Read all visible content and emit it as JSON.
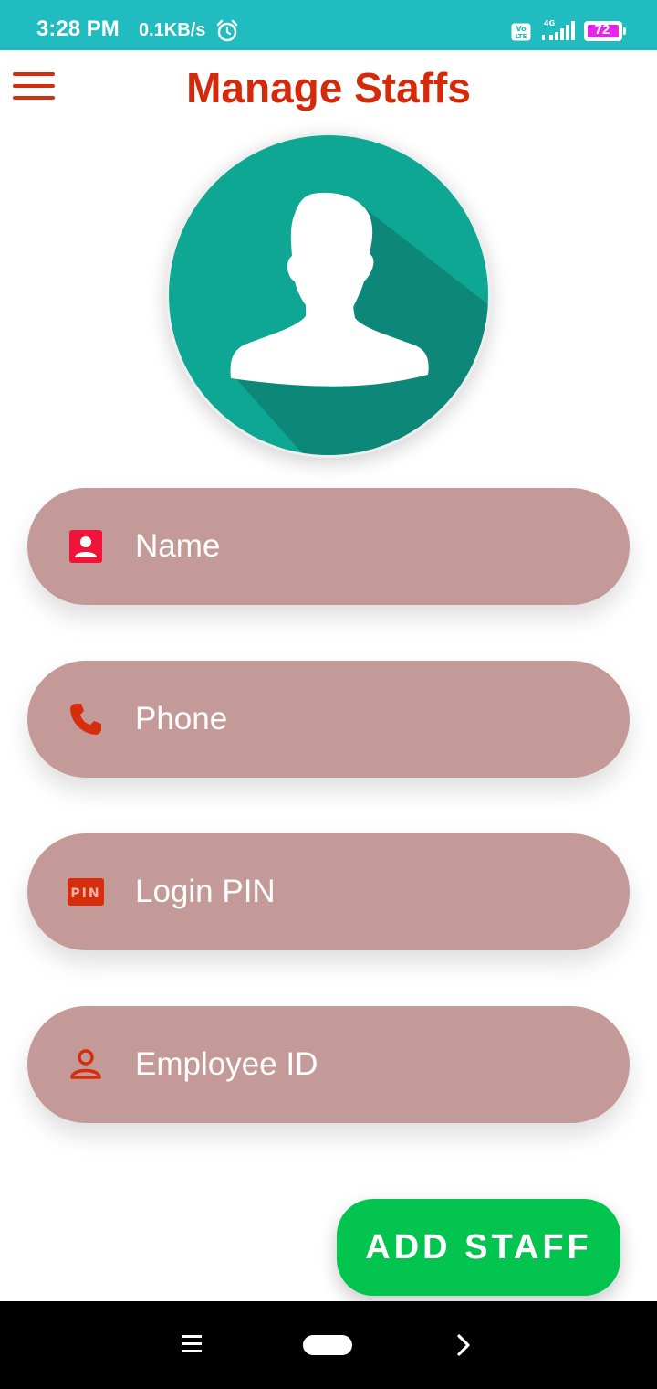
{
  "status_bar": {
    "time": "3:28 PM",
    "network_speed": "0.1KB/s",
    "network_type": "4G",
    "volte": "Vo LTE",
    "battery_level": "72",
    "icons": [
      "alarm-icon",
      "volte-icon",
      "signal-icon",
      "battery-icon"
    ]
  },
  "app_bar": {
    "title": "Manage Staffs",
    "menu_icon": "hamburger-menu-icon"
  },
  "form": {
    "fields": [
      {
        "placeholder": "Name",
        "icon": "contact-card-icon"
      },
      {
        "placeholder": "Phone",
        "icon": "phone-icon"
      },
      {
        "placeholder": "Login PIN",
        "icon": "pin-icon",
        "icon_text": "PIN"
      },
      {
        "placeholder": "Employee ID",
        "icon": "person-outline-icon"
      }
    ],
    "submit_label": "ADD STAFF"
  },
  "colors": {
    "status_bar": "#20bcbf",
    "title": "#d42a0a",
    "field_background": "#c49a98",
    "button": "#04c450",
    "avatar_background": "#0ea793"
  },
  "nav_bar": {
    "icons": [
      "recents-menu-icon",
      "home-pill-icon",
      "back-chevron-icon"
    ]
  }
}
